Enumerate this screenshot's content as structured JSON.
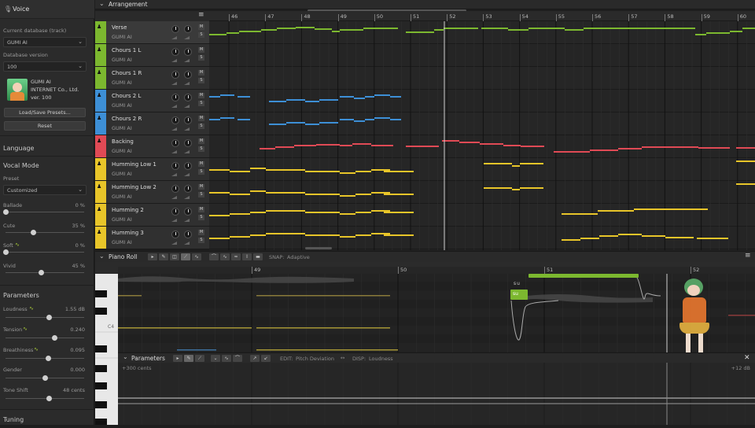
{
  "sidebar": {
    "title": "Voice",
    "db_label": "Current database (track)",
    "db_value": "GUMI AI",
    "version_label": "Database version",
    "version_value": "100",
    "voice_name": "GUMI AI",
    "voice_company": "INTERNET Co., Ltd.",
    "voice_version": "ver. 100",
    "presets_button": "Load/Save Presets...",
    "reset_button": "Reset",
    "language_section": "Language",
    "vocal_mode_section": "Vocal Mode",
    "preset_label": "Preset",
    "preset_value": "Customized",
    "vocal_modes": [
      {
        "name": "Ballade",
        "value": "0 %",
        "level": 0
      },
      {
        "name": "Cute",
        "value": "35 %",
        "level": 0.35
      },
      {
        "name": "Soft",
        "value": "0 %",
        "level": 0
      },
      {
        "name": "Vivid",
        "value": "45 %",
        "level": 0.45
      }
    ],
    "parameters_section": "Parameters",
    "parameters": [
      {
        "name": "Loudness",
        "value": "1.55 dB",
        "level": 0.55
      },
      {
        "name": "Tension",
        "value": "0.240",
        "level": 0.62
      },
      {
        "name": "Breathiness",
        "value": "0.095",
        "level": 0.54
      },
      {
        "name": "Gender",
        "value": "0.000",
        "level": 0.5
      },
      {
        "name": "Tone Shift",
        "value": "48 cents",
        "level": 0.55
      }
    ],
    "tuning_section": "Tuning"
  },
  "arrangement": {
    "title": "Arrangement",
    "bars": [
      "46",
      "47",
      "48",
      "49",
      "50",
      "51",
      "52",
      "53",
      "54",
      "55",
      "56",
      "57",
      "58",
      "59",
      "60"
    ],
    "tracks": [
      {
        "name": "Verse",
        "voice": "GUMI AI",
        "color": "#7cb82f",
        "mute": "M",
        "solo": "S"
      },
      {
        "name": "Chours 1 L",
        "voice": "GUMI AI",
        "color": "#7cb82f",
        "mute": "M",
        "solo": "S"
      },
      {
        "name": "Chours 1 R",
        "voice": "GUMI AI",
        "color": "#7cb82f",
        "mute": "M",
        "solo": "S"
      },
      {
        "name": "Chours 2 L",
        "voice": "GUMI AI",
        "color": "#3d8fd6",
        "mute": "M",
        "solo": "S"
      },
      {
        "name": "Chours 2 R",
        "voice": "GUMI AI",
        "color": "#3d8fd6",
        "mute": "M",
        "solo": "S"
      },
      {
        "name": "Backing",
        "voice": "GUMI AI",
        "color": "#e04a55",
        "mute": "M",
        "solo": "S"
      },
      {
        "name": "Humming Low 1",
        "voice": "GUMI AI",
        "color": "#e8c529",
        "mute": "M",
        "solo": "S"
      },
      {
        "name": "Humming Low 2",
        "voice": "GUMI AI",
        "color": "#e8c529",
        "mute": "M",
        "solo": "S"
      },
      {
        "name": "Humming 2",
        "voice": "GUMI AI",
        "color": "#e8c529",
        "mute": "M",
        "solo": "S"
      },
      {
        "name": "Humming 3",
        "voice": "GUMI AI",
        "color": "#e8c529",
        "mute": "M",
        "solo": "S"
      }
    ]
  },
  "piano_roll": {
    "title": "Piano Roll",
    "snap_label": "SNAP:",
    "snap_value": "Adaptive",
    "bars": [
      "49",
      "50",
      "51",
      "52"
    ],
    "key_label": "C4",
    "lyric": "su",
    "note_label": "su"
  },
  "parameters_panel": {
    "title": "Parameters",
    "edit_label": "EDIT:",
    "edit_value": "Pitch Deviation",
    "disp_label": "DISP:",
    "disp_value": "Loudness",
    "left_scale": "+300 cents",
    "right_scale": "+12 dB"
  },
  "colors": {
    "green": "#7cb82f",
    "blue": "#3d8fd6",
    "red": "#e04a55",
    "yellow": "#e8c529"
  }
}
